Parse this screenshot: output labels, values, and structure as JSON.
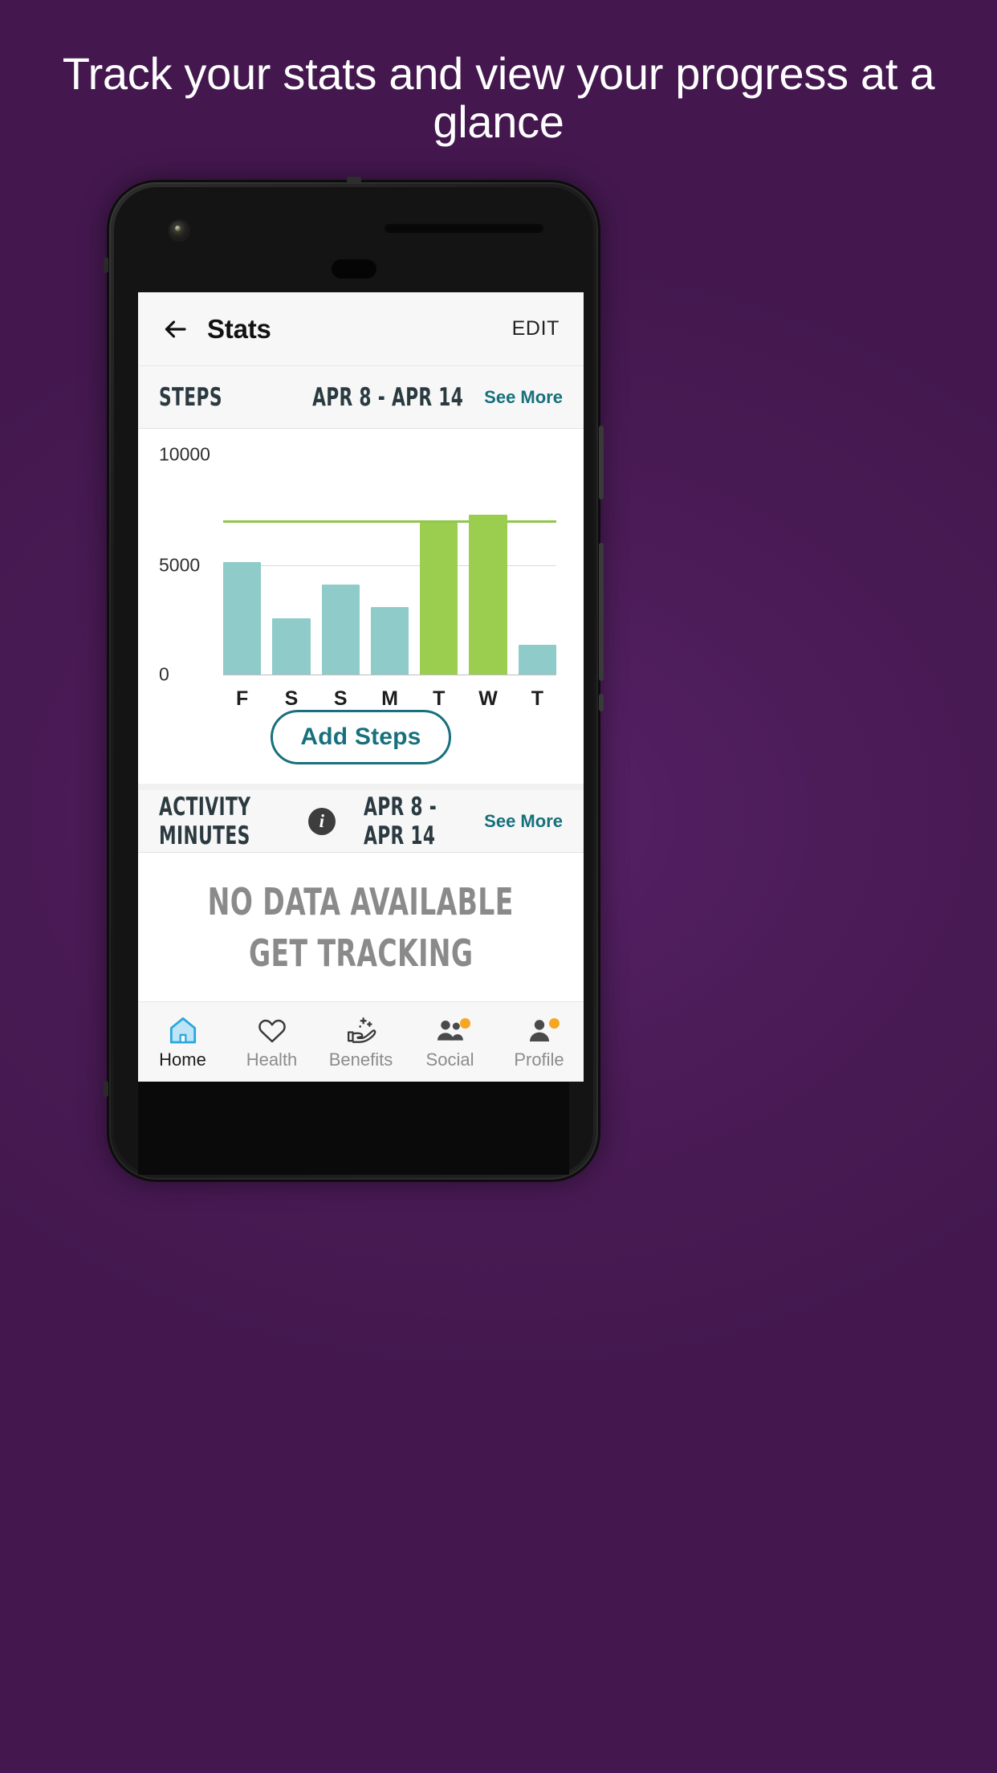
{
  "headline": "Track your stats and view your progress at a glance",
  "app": {
    "back_icon": "arrow-left-icon",
    "title": "Stats",
    "edit_label": "EDIT"
  },
  "steps_section": {
    "title": "STEPS",
    "date_range": "APR 8 - APR 14",
    "see_more": "See More",
    "add_button": "Add Steps"
  },
  "activity_section": {
    "title": "ACTIVITY MINUTES",
    "info_icon": "info-icon",
    "info_glyph": "i",
    "date_range": "APR 8 - APR 14",
    "see_more": "See More",
    "empty_line_1": "NO DATA AVAILABLE",
    "empty_line_2": "GET TRACKING"
  },
  "bottom_nav": [
    {
      "label": "Home",
      "icon": "home-icon",
      "active": true,
      "badge": false
    },
    {
      "label": "Health",
      "icon": "heart-icon",
      "active": false,
      "badge": false
    },
    {
      "label": "Benefits",
      "icon": "hand-sparkle-icon",
      "active": false,
      "badge": false
    },
    {
      "label": "Social",
      "icon": "people-icon",
      "active": false,
      "badge": true
    },
    {
      "label": "Profile",
      "icon": "person-icon",
      "active": false,
      "badge": true
    }
  ],
  "colors": {
    "background": "#4a1b56",
    "teal_bar": "#8fcbc8",
    "green_bar": "#9bcd4e",
    "goal_line": "#8fc64b",
    "link_teal": "#17707c",
    "badge_orange": "#f5a623",
    "active_nav": "#29a8df"
  },
  "chart_data": {
    "type": "bar",
    "title": "STEPS",
    "xlabel": "",
    "ylabel": "",
    "categories": [
      "F",
      "S",
      "S",
      "M",
      "T",
      "W",
      "T"
    ],
    "values": [
      5100,
      2550,
      4100,
      3050,
      6900,
      7250,
      1350
    ],
    "bar_colors": [
      "#8fcbc8",
      "#8fcbc8",
      "#8fcbc8",
      "#8fcbc8",
      "#9bcd4e",
      "#9bcd4e",
      "#8fcbc8"
    ],
    "ylim": [
      0,
      10000
    ],
    "ytick_labels": [
      "10000",
      "5000",
      "0"
    ],
    "yticks": [
      10000,
      5000,
      0
    ],
    "goal_line_value": 7000,
    "grid": true,
    "legend": false
  }
}
